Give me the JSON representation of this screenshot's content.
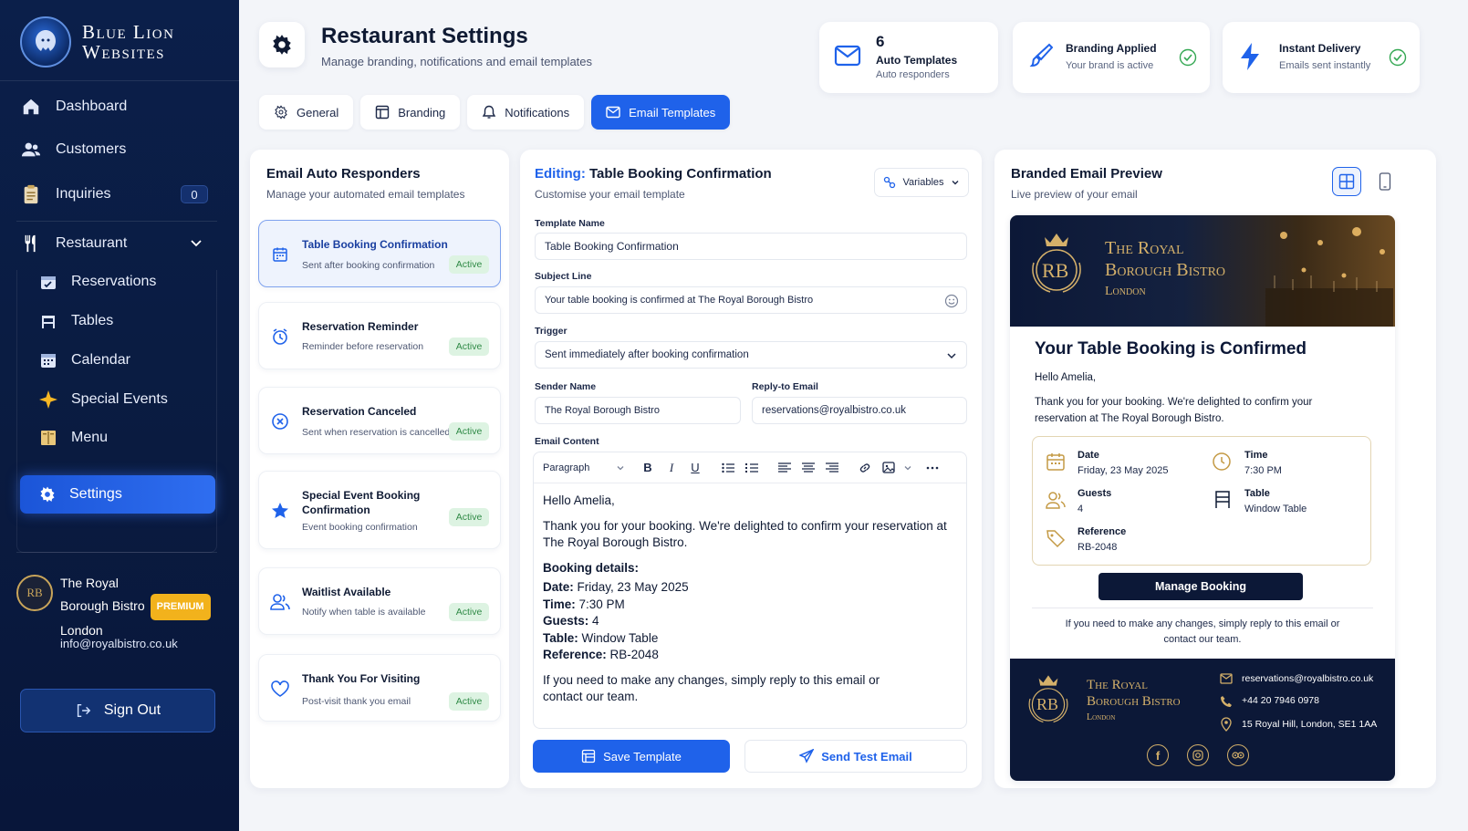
{
  "brand": {
    "line1": "Blue Lion",
    "line2": "Websites"
  },
  "nav": {
    "dashboard": "Dashboard",
    "customers": "Customers",
    "inquiries": "Inquiries",
    "inquiries_count": "0",
    "restaurant": "Restaurant"
  },
  "subnav": {
    "reservations": "Reservations",
    "tables": "Tables",
    "calendar": "Calendar",
    "special_events": "Special Events",
    "menu": "Menu",
    "settings": "Settings"
  },
  "profile": {
    "name_l1": "The Royal",
    "name_l2": "Borough Bistro",
    "name_l3": "London",
    "badge": "PREMIUM",
    "email": "info@royalbistro.co.uk",
    "avatar": "RB"
  },
  "signout": "Sign Out",
  "header": {
    "title": "Restaurant Settings",
    "subtitle": "Manage branding, notifications and email templates"
  },
  "stats": {
    "templates_count": "6",
    "templates_label": "Auto Templates",
    "templates_sub": "Auto responders",
    "branding_label": "Branding Applied",
    "branding_sub": "Your brand is active",
    "delivery_label": "Instant Delivery",
    "delivery_sub": "Emails sent instantly"
  },
  "tabs": {
    "general": "General",
    "branding": "Branding",
    "notifications": "Notifications",
    "email_templates": "Email Templates"
  },
  "responders": {
    "title": "Email Auto Responders",
    "subtitle": "Manage your automated email templates",
    "status": "Active",
    "items": [
      {
        "name": "Table Booking Confirmation",
        "desc": "Sent after booking confirmation"
      },
      {
        "name": "Reservation Reminder",
        "desc": "Reminder before reservation"
      },
      {
        "name": "Reservation Canceled",
        "desc": "Sent when reservation is cancelled"
      },
      {
        "name": "Special Event Booking Confirmation",
        "desc": "Event booking confirmation"
      },
      {
        "name": "Waitlist Available",
        "desc": "Notify when table is available"
      },
      {
        "name": "Thank You For Visiting",
        "desc": "Post-visit thank you email"
      }
    ]
  },
  "editor": {
    "editing_label": "Editing:",
    "title": "Table Booking Confirmation",
    "subtitle": "Customise your email template",
    "variables": "Variables",
    "template_name_label": "Template Name",
    "template_name": "Table Booking Confirmation",
    "subject_label": "Subject Line",
    "subject": "Your table booking is confirmed at The Royal Borough Bistro",
    "trigger_label": "Trigger",
    "trigger": "Sent immediately after booking confirmation",
    "sender_label": "Sender Name",
    "sender": "The Royal Borough Bistro",
    "reply_label": "Reply-to Email",
    "reply": "reservations@royalbistro.co.uk",
    "content_label": "Email Content",
    "paragraph": "Paragraph",
    "greeting": "Hello Amelia,",
    "body1": "Thank you for your booking. We're delighted to confirm your reservation at The Royal Borough Bistro.",
    "details_heading": "Booking details:",
    "date_k": "Date:",
    "date_v": "Friday, 23 May 2025",
    "time_k": "Time:",
    "time_v": "7:30 PM",
    "guests_k": "Guests:",
    "guests_v": "4",
    "table_k": "Table:",
    "table_v": "Window Table",
    "ref_k": "Reference:",
    "ref_v": "RB-2048",
    "closing": "If you need to make any changes, simply reply to this email or contact our team.",
    "save": "Save Template",
    "test": "Send Test Email"
  },
  "preview": {
    "title": "Branded Email Preview",
    "subtitle": "Live preview of your email",
    "brand_l1": "The Royal",
    "brand_l2": "Borough Bistro",
    "brand_l3": "London",
    "monogram": "RB",
    "heading": "Your Table Booking is Confirmed",
    "greeting": "Hello Amelia,",
    "body": "Thank you for your booking. We're delighted to confirm your reservation at The Royal Borough Bistro.",
    "date_k": "Date",
    "date_v": "Friday, 23 May 2025",
    "time_k": "Time",
    "time_v": "7:30 PM",
    "guests_k": "Guests",
    "guests_v": "4",
    "table_k": "Table",
    "table_v": "Window Table",
    "ref_k": "Reference",
    "ref_v": "RB-2048",
    "button": "Manage Booking",
    "note": "If you need to make any changes, simply reply to this email or contact our team.",
    "f_email": "reservations@royalbistro.co.uk",
    "f_phone": "+44 20 7946 0978",
    "f_addr": "15 Royal Hill, London, SE1 1AA"
  },
  "colors": {
    "accent": "#1f62ea",
    "sidebar": "#0b1f4a",
    "gold": "#d4b06a",
    "active_green": "#2f8a46",
    "premium": "#f2b21c"
  }
}
